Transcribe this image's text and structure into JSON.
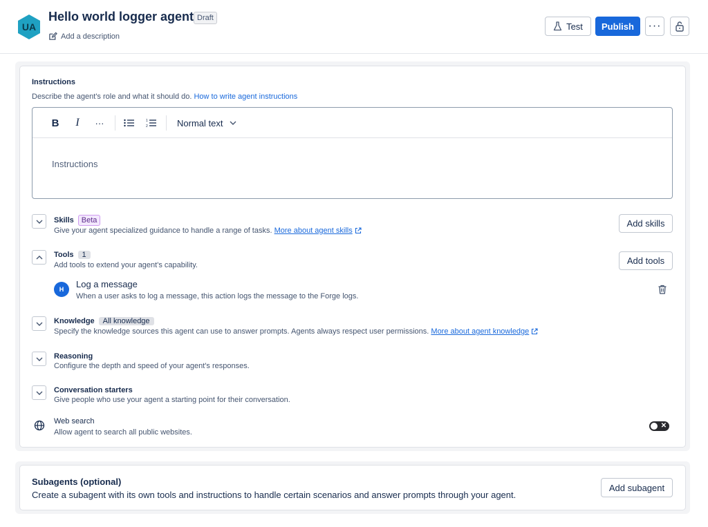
{
  "header": {
    "avatar_initials": "UA",
    "avatar_color": "#1fa1c2",
    "title": "Hello world logger agent",
    "status_badge": "Draft",
    "add_description": "Add a description",
    "test_label": "Test",
    "publish_label": "Publish",
    "more_label": "···",
    "accent_color": "#1868db"
  },
  "instructions": {
    "title": "Instructions",
    "description": "Describe the agent's role and what it should do.",
    "help_link": "How to write agent instructions",
    "toolbar": {
      "bold": "B",
      "italic": "I",
      "more": "···",
      "text_style": "Normal text"
    },
    "placeholder": "Instructions"
  },
  "sections": {
    "skills": {
      "title": "Skills",
      "badge": "Beta",
      "description": "Give your agent specialized guidance to handle a range of tasks.",
      "link": "More about agent skills",
      "button": "Add skills"
    },
    "tools": {
      "title": "Tools",
      "count": "1",
      "description": "Add tools to extend your agent's capability.",
      "button": "Add tools",
      "items": [
        {
          "initial": "H",
          "name": "Log a message",
          "description": "When a user asks to log a message, this action logs the message to the Forge logs."
        }
      ]
    },
    "knowledge": {
      "title": "Knowledge",
      "badge": "All knowledge",
      "description": "Specify the knowledge sources this agent can use to answer prompts. Agents always respect user permissions.",
      "link": "More about agent knowledge"
    },
    "reasoning": {
      "title": "Reasoning",
      "description": "Configure the depth and speed of your agent's responses."
    },
    "conversation_starters": {
      "title": "Conversation starters",
      "description": "Give people who use your agent a starting point for their conversation."
    },
    "web_search": {
      "title": "Web search",
      "description": "Allow agent to search all public websites.",
      "enabled": false
    }
  },
  "subagents": {
    "title": "Subagents (optional)",
    "description": "Create a subagent with its own tools and instructions to handle certain scenarios and answer prompts through your agent.",
    "button": "Add subagent"
  }
}
